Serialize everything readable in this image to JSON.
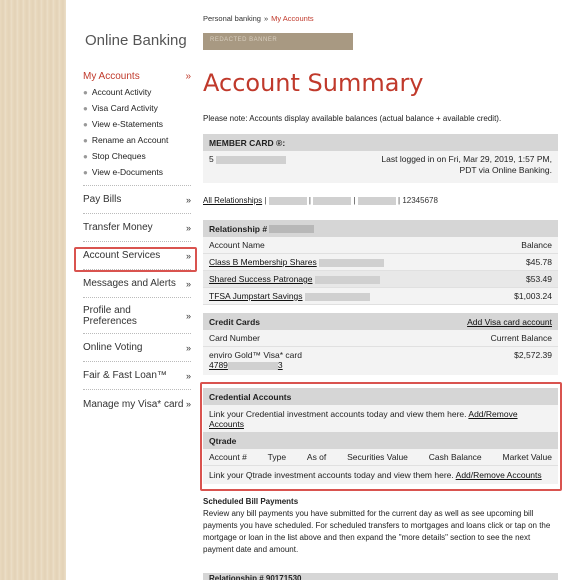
{
  "sidebar": {
    "title": "Online Banking",
    "my_accounts": {
      "label": "My Accounts",
      "chevron": "»"
    },
    "sub_items": [
      "Account Activity",
      "Visa Card Activity",
      "View e-Statements",
      "Rename an Account",
      "Stop Cheques",
      "View e-Documents"
    ],
    "items": [
      {
        "label": "Pay Bills",
        "chevron": "»"
      },
      {
        "label": "Transfer Money",
        "chevron": "»"
      },
      {
        "label": "Account Services",
        "chevron": "»"
      },
      {
        "label": "Messages and Alerts",
        "chevron": "»"
      },
      {
        "label": "Profile and Preferences",
        "chevron": "»"
      },
      {
        "label": "Online Voting",
        "chevron": "»"
      },
      {
        "label": "Fair & Fast Loan™",
        "chevron": "»"
      },
      {
        "label": "Manage my Visa* card",
        "chevron": "»"
      }
    ]
  },
  "breadcrumb": {
    "root": "Personal banking",
    "sep": "»",
    "current": "My Accounts"
  },
  "banner": {
    "text": "REDACTED BANNER"
  },
  "page": {
    "title": "Account Summary",
    "note": "Please note: Accounts display available balances (actual balance + available credit)."
  },
  "member": {
    "header": "MEMBER CARD ®:",
    "card_prefix": "5",
    "last_login": "Last logged in on Fri, Mar 29, 2019, 1:57 PM, PDT via Online Banking."
  },
  "relationships": {
    "all": "All Relationships",
    "number": "12345678"
  },
  "relationship_panel": {
    "header": "Relationship #",
    "col_name": "Account Name",
    "col_balance": "Balance",
    "accounts": [
      {
        "name": "Class B Membership Shares",
        "balance": "$45.78"
      },
      {
        "name": "Shared Success Patronage",
        "balance": "$53.49"
      },
      {
        "name": "TFSA Jumpstart Savings",
        "balance": "$1,003.24"
      }
    ]
  },
  "credit_cards": {
    "header": "Credit Cards",
    "add_link": "Add Visa card account",
    "col_card": "Card Number",
    "col_balance": "Current Balance",
    "card_name": "enviro Gold™ Visa* card",
    "card_number_prefix": "4789",
    "card_number_suffix": "3",
    "balance": "$2,572.39"
  },
  "credential": {
    "header": "Credential Accounts",
    "text": "Link your Credential investment accounts today and view them here.",
    "link": "Add/Remove Accounts"
  },
  "qtrade": {
    "header": "Qtrade",
    "columns": [
      "Account #",
      "Type",
      "As of",
      "Securities Value",
      "Cash Balance",
      "Market Value"
    ],
    "text": "Link your Qtrade investment accounts today and view them here.",
    "link": "Add/Remove Accounts"
  },
  "scheduled": {
    "title": "Scheduled Bill Payments",
    "body": "Review any bill payments you have submitted for the current day as well as see upcoming bill payments you have scheduled. For scheduled transfers to mortgages and loans click or tap on the mortgage or loan in the list above and then expand the \"more details\" section to see the next payment date and amount."
  },
  "relationship2": {
    "header": "Relationship # 90171530"
  }
}
